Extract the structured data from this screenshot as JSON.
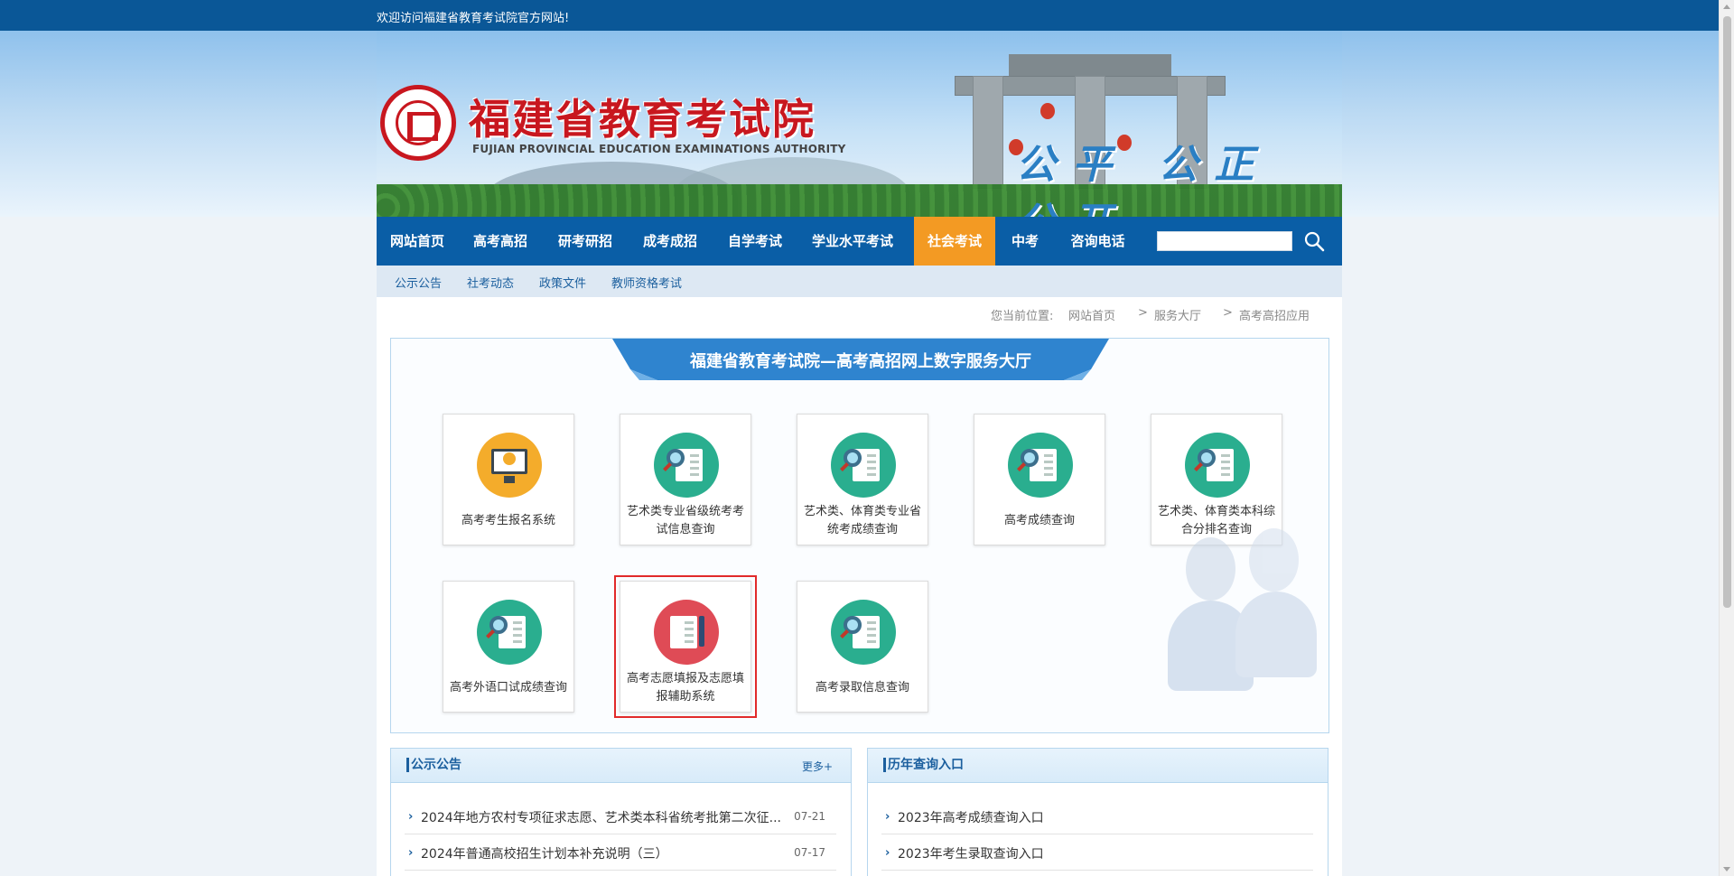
{
  "topbar": {
    "welcome": "欢迎访问福建省教育考试院官方网站!"
  },
  "header": {
    "title": "福建省教育考试院",
    "subtitle": "FUJIAN PROVINCIAL EDUCATION EXAMINATIONS AUTHORITY",
    "slogan": "公平 公正 公开"
  },
  "nav": {
    "items": [
      {
        "label": "网站首页"
      },
      {
        "label": "高考高招"
      },
      {
        "label": "研考研招"
      },
      {
        "label": "成考成招"
      },
      {
        "label": "自学考试"
      },
      {
        "label": "学业水平考试"
      },
      {
        "label": "社会考试"
      },
      {
        "label": "中考"
      },
      {
        "label": "咨询电话"
      }
    ],
    "active_index": 6,
    "search_value": ""
  },
  "subnav": {
    "items": [
      {
        "label": "公示公告"
      },
      {
        "label": "社考动态"
      },
      {
        "label": "政策文件"
      },
      {
        "label": "教师资格考试"
      }
    ]
  },
  "breadcrumb": {
    "prefix": "您当前位置:",
    "items": [
      "网站首页",
      "服务大厅",
      "高考高招应用"
    ],
    "separator": ">"
  },
  "service_hall": {
    "title": "福建省教育考试院—高考高招网上数字服务大厅",
    "tiles": [
      {
        "label": "高考考生报名系统",
        "icon": "upload-monitor-icon",
        "color": "#f4ac2b"
      },
      {
        "label": "艺术类专业省级统考考试信息查询",
        "icon": "score-search-icon",
        "color": "#2aae8f"
      },
      {
        "label": "艺术类、体育类专业省统考成绩查询",
        "icon": "score-search-icon",
        "color": "#2aae8f"
      },
      {
        "label": "高考成绩查询",
        "icon": "score-search-icon",
        "color": "#2aae8f"
      },
      {
        "label": "艺术类、体育类本科综合分排名查询",
        "icon": "score-search-icon",
        "color": "#2aae8f"
      },
      {
        "label": "高考外语口试成绩查询",
        "icon": "score-search-icon",
        "color": "#2aae8f"
      },
      {
        "label": "高考志愿填报及志愿填报辅助系统",
        "icon": "checklist-pencil-icon",
        "color": "#df4b56",
        "highlighted": true
      },
      {
        "label": "高考录取信息查询",
        "icon": "score-search-icon",
        "color": "#2aae8f"
      }
    ]
  },
  "notices": {
    "title": "公示公告",
    "more": "更多+",
    "items": [
      {
        "title": "2024年地方农村专项征求志愿、艺术类本科省统考批第二次征...",
        "date": "07-21"
      },
      {
        "title": "2024年普通高校招生计划本补充说明（三）",
        "date": "07-17"
      }
    ]
  },
  "history": {
    "title": "历年查询入口",
    "items": [
      {
        "title": "2023年高考成绩查询入口"
      },
      {
        "title": "2023年考生录取查询入口"
      }
    ]
  },
  "colors": {
    "topbar": "#0a5797",
    "nav": "#0a5ea6",
    "nav_active": "#f39a23",
    "brand_red": "#c8171f",
    "highlight_border": "#e12a2a"
  }
}
